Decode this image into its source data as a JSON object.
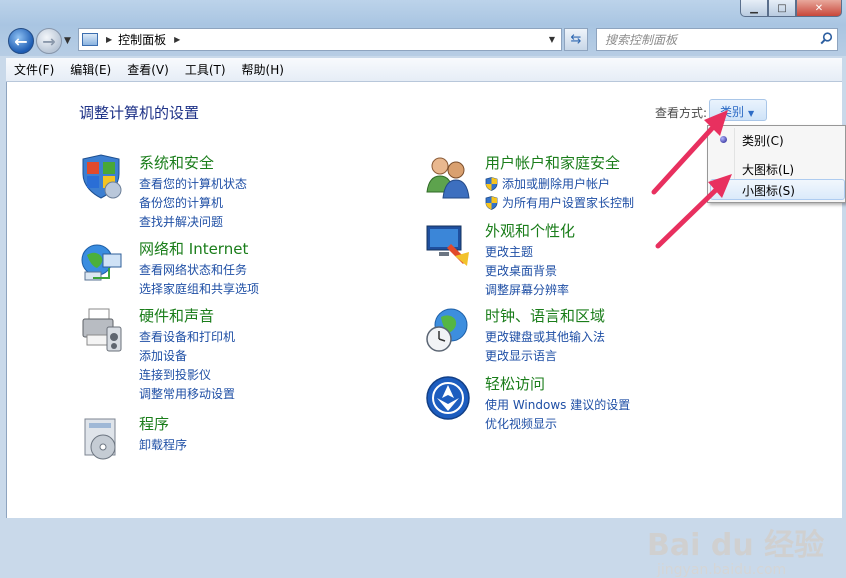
{
  "window": {
    "min_glyph": "▁",
    "max_glyph": "□",
    "close_glyph": "✕"
  },
  "nav": {
    "back_glyph": "←",
    "forward_glyph": "→"
  },
  "address": {
    "path": "控制面板"
  },
  "search": {
    "placeholder": "搜索控制面板"
  },
  "menu": [
    "文件(F)",
    "编辑(E)",
    "查看(V)",
    "工具(T)",
    "帮助(H)"
  ],
  "page": {
    "title": "调整计算机的设置",
    "view_by_label": "查看方式:",
    "view_by_value": "类别"
  },
  "categories": [
    {
      "title": "系统和安全",
      "icon": "system-security-icon",
      "links": [
        {
          "text": "查看您的计算机状态",
          "shield": false
        },
        {
          "text": "备份您的计算机",
          "shield": false
        },
        {
          "text": "查找并解决问题",
          "shield": false
        }
      ]
    },
    {
      "title": "网络和 Internet",
      "icon": "network-icon",
      "links": [
        {
          "text": "查看网络状态和任务",
          "shield": false
        },
        {
          "text": "选择家庭组和共享选项",
          "shield": false
        }
      ]
    },
    {
      "title": "硬件和声音",
      "icon": "printer-icon",
      "links": [
        {
          "text": "查看设备和打印机",
          "shield": false
        },
        {
          "text": "添加设备",
          "shield": false
        },
        {
          "text": "连接到投影仪",
          "shield": false
        },
        {
          "text": "调整常用移动设置",
          "shield": false
        }
      ]
    },
    {
      "title": "程序",
      "icon": "programs-icon",
      "links": [
        {
          "text": "卸载程序",
          "shield": false
        }
      ]
    },
    {
      "title": "用户帐户和家庭安全",
      "icon": "users-icon",
      "links": [
        {
          "text": "添加或删除用户帐户",
          "shield": true
        },
        {
          "text": "为所有用户设置家长控制",
          "shield": true
        }
      ]
    },
    {
      "title": "外观和个性化",
      "icon": "appearance-icon",
      "links": [
        {
          "text": "更改主题",
          "shield": false
        },
        {
          "text": "更改桌面背景",
          "shield": false
        },
        {
          "text": "调整屏幕分辨率",
          "shield": false
        }
      ]
    },
    {
      "title": "时钟、语言和区域",
      "icon": "clock-globe-icon",
      "links": [
        {
          "text": "更改键盘或其他输入法",
          "shield": false
        },
        {
          "text": "更改显示语言",
          "shield": false
        }
      ]
    },
    {
      "title": "轻松访问",
      "icon": "ease-of-access-icon",
      "links": [
        {
          "text": "使用 Windows 建议的设置",
          "shield": false
        },
        {
          "text": "优化视频显示",
          "shield": false
        }
      ]
    }
  ],
  "view_menu": {
    "items": [
      "类别(C)",
      "大图标(L)",
      "小图标(S)"
    ],
    "selected": 0,
    "hovered": 2
  },
  "watermark": {
    "logo": "Bai du 经验",
    "url": "jingyan.baidu.com"
  },
  "colors": {
    "title_blue": "#1e3287",
    "category_green": "#1a7d1a",
    "link_blue": "#1f4fa5",
    "arrow_pink": "#e8305f"
  }
}
